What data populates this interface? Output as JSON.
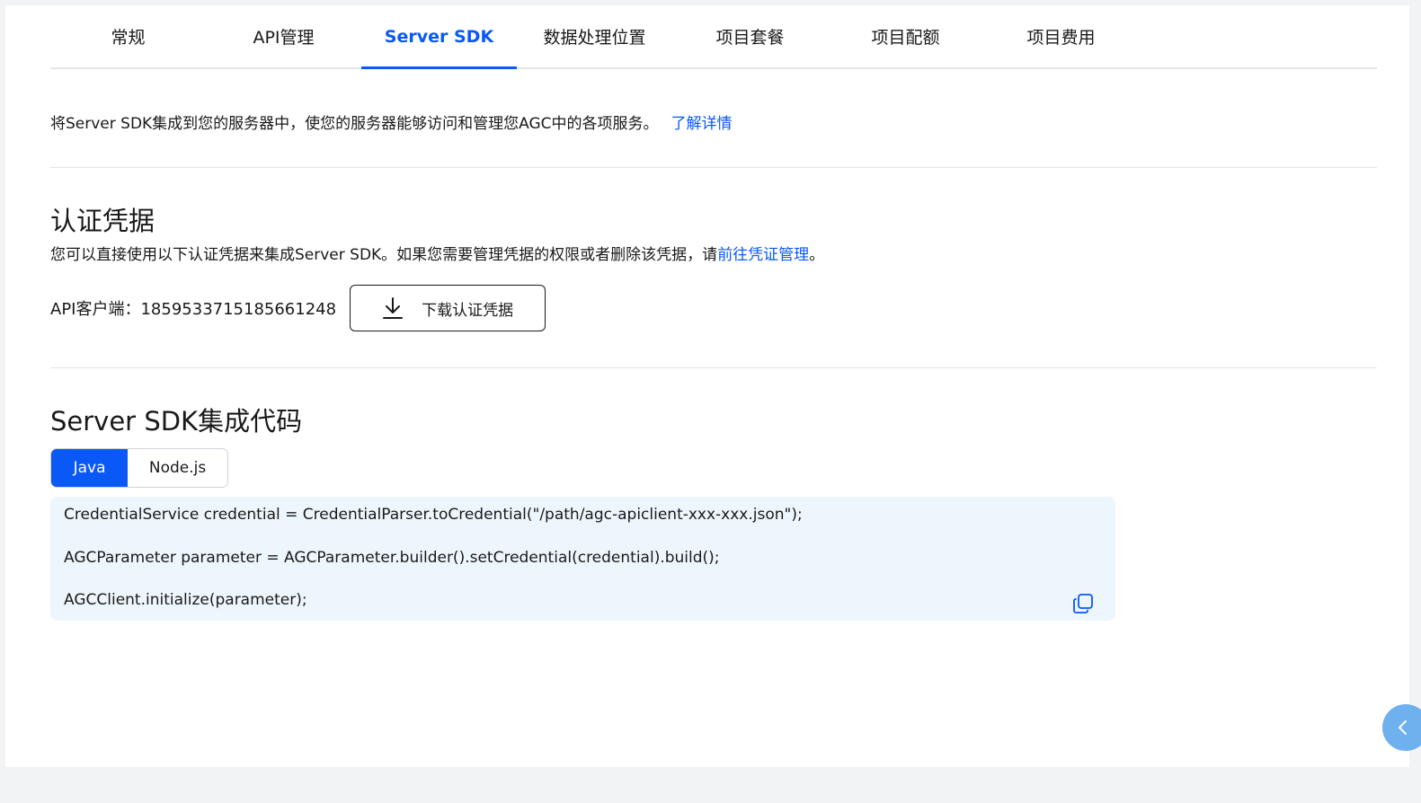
{
  "tabs": [
    {
      "label": "常规"
    },
    {
      "label": "API管理"
    },
    {
      "label": "Server SDK",
      "active": true
    },
    {
      "label": "数据处理位置"
    },
    {
      "label": "项目套餐"
    },
    {
      "label": "项目配额"
    },
    {
      "label": "项目费用"
    }
  ],
  "intro": {
    "text": "将Server SDK集成到您的服务器中，使您的服务器能够访问和管理您AGC中的各项服务。",
    "link": "了解详情"
  },
  "credentials": {
    "title": "认证凭据",
    "desc_prefix": "您可以直接使用以下认证凭据来集成Server SDK。如果您需要管理凭据的权限或者删除该凭据，请",
    "desc_link": "前往凭证管理",
    "desc_suffix": "。",
    "client_label": "API客户端：1859533715185661248",
    "download_label": "下载认证凭据"
  },
  "sdk": {
    "title": "Server SDK集成代码",
    "lang_tabs": [
      {
        "label": "Java",
        "active": true
      },
      {
        "label": "Node.js"
      }
    ],
    "code_lines": [
      "CredentialService credential = CredentialParser.toCredential(\"/path/agc-apiclient-xxx-xxx.json\");",
      "AGCParameter parameter = AGCParameter.builder().setCredential(credential).build();",
      "AGCClient.initialize(parameter);"
    ]
  },
  "icons": {
    "download": "download-icon",
    "copy": "copy-icon",
    "float": "chevron-left-icon"
  },
  "colors": {
    "accent": "#0a59f7",
    "code_bg": "#eef6fd",
    "float_btn": "#6fb0ee"
  }
}
